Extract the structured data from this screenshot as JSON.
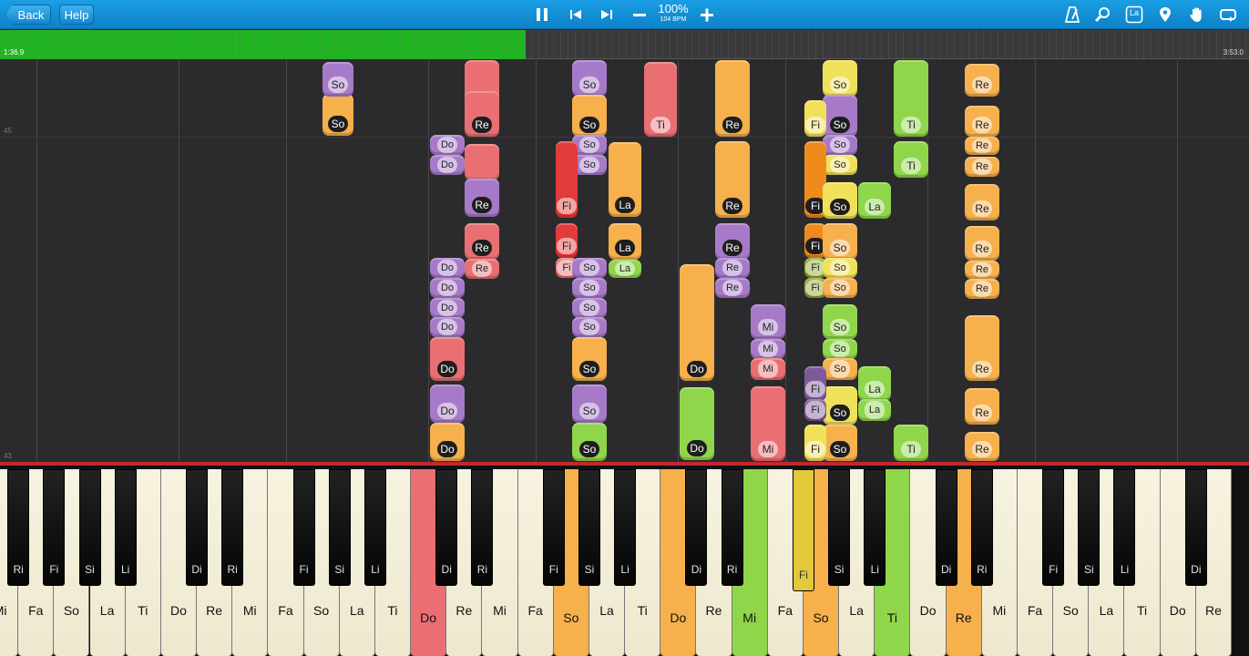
{
  "toolbar": {
    "back_label": "Back",
    "help_label": "Help",
    "zoom": "100%",
    "tempo": "104 BPM",
    "icons": [
      "pause-icon",
      "skip-back-icon",
      "skip-forward-icon",
      "zoom-out-icon",
      "zoom-in-icon",
      "metronome-icon",
      "search-icon",
      "note-label-icon",
      "location-pin-icon",
      "hand-icon",
      "loop-icon"
    ],
    "note_label_icon_text": "La",
    "accent": "#1591d6"
  },
  "progress": {
    "elapsed": "1:36.9",
    "total": "3:53.0",
    "fraction": 0.421
  },
  "measures": [
    "45",
    "43"
  ],
  "colors": {
    "orange": "#f6b04c",
    "purple": "#a77ac9",
    "pink": "#ea6f72",
    "red": "#e33a3a",
    "green": "#8fd64a",
    "yellow": "#f1e15a",
    "deeporange": "#ef8a1c",
    "olive": "#8fa62a",
    "darkpurple": "#7e5a9a"
  },
  "notes": [
    [
      "orange",
      354,
      103,
      34,
      46,
      "So",
      1
    ],
    [
      "purple",
      354,
      68,
      34,
      38,
      "So",
      0
    ],
    [
      "purple",
      472,
      148,
      38,
      22,
      "Do",
      0
    ],
    [
      "purple",
      472,
      170,
      38,
      22,
      "Do",
      0
    ],
    [
      "pink",
      510,
      66,
      38,
      84,
      "Re",
      0
    ],
    [
      "pink",
      510,
      100,
      38,
      50,
      "Re",
      1
    ],
    [
      "pink",
      510,
      158,
      38,
      40,
      "",
      0
    ],
    [
      "purple",
      510,
      196,
      38,
      42,
      "Re",
      1
    ],
    [
      "pink",
      510,
      245,
      38,
      40,
      "Re",
      1
    ],
    [
      "pink",
      510,
      284,
      38,
      22,
      "Re",
      0
    ],
    [
      "purple",
      472,
      283,
      38,
      22,
      "Do",
      0
    ],
    [
      "purple",
      472,
      305,
      38,
      22,
      "Do",
      0
    ],
    [
      "purple",
      472,
      327,
      38,
      22,
      "Do",
      0
    ],
    [
      "purple",
      472,
      348,
      38,
      22,
      "Do",
      0
    ],
    [
      "pink",
      472,
      370,
      38,
      48,
      "Do",
      1
    ],
    [
      "purple",
      472,
      422,
      38,
      42,
      "Do",
      0
    ],
    [
      "orange",
      472,
      464,
      38,
      42,
      "Do",
      1
    ],
    [
      "purple",
      628,
      66,
      38,
      40,
      "So",
      0
    ],
    [
      "orange",
      628,
      104,
      38,
      46,
      "So",
      1
    ],
    [
      "purple",
      628,
      148,
      38,
      22,
      "So",
      0
    ],
    [
      "purple",
      628,
      170,
      38,
      22,
      "So",
      0
    ],
    [
      "red",
      610,
      155,
      24,
      84,
      "Fi",
      0
    ],
    [
      "red",
      610,
      245,
      24,
      38,
      "Fi",
      0
    ],
    [
      "pink",
      610,
      283,
      24,
      22,
      "Fi",
      0
    ],
    [
      "orange",
      668,
      156,
      36,
      82,
      "La",
      1
    ],
    [
      "orange",
      668,
      245,
      36,
      40,
      "La",
      1
    ],
    [
      "green",
      668,
      285,
      36,
      20,
      "La",
      0
    ],
    [
      "purple",
      628,
      283,
      38,
      22,
      "So",
      0
    ],
    [
      "purple",
      628,
      305,
      38,
      22,
      "So",
      0
    ],
    [
      "purple",
      628,
      327,
      38,
      22,
      "So",
      0
    ],
    [
      "purple",
      628,
      348,
      38,
      22,
      "So",
      0
    ],
    [
      "orange",
      628,
      370,
      38,
      48,
      "So",
      1
    ],
    [
      "purple",
      628,
      422,
      38,
      42,
      "So",
      0
    ],
    [
      "green",
      628,
      464,
      38,
      42,
      "So",
      1
    ],
    [
      "pink",
      707,
      68,
      36,
      82,
      "Ti",
      0
    ],
    [
      "orange",
      785,
      66,
      38,
      84,
      "Re",
      1
    ],
    [
      "orange",
      785,
      155,
      38,
      84,
      "Re",
      1
    ],
    [
      "purple",
      785,
      245,
      38,
      40,
      "Re",
      1
    ],
    [
      "purple",
      785,
      283,
      38,
      22,
      "Re",
      0
    ],
    [
      "purple",
      785,
      305,
      38,
      22,
      "Re",
      0
    ],
    [
      "orange",
      746,
      290,
      38,
      128,
      "Do",
      1
    ],
    [
      "green",
      746,
      425,
      38,
      80,
      "Do",
      1
    ],
    [
      "purple",
      824,
      334,
      38,
      38,
      "Mi",
      0
    ],
    [
      "purple",
      824,
      372,
      38,
      22,
      "Mi",
      0
    ],
    [
      "pink",
      824,
      393,
      38,
      24,
      "Mi",
      0
    ],
    [
      "pink",
      824,
      424,
      38,
      82,
      "Mi",
      0
    ],
    [
      "yellow",
      903,
      66,
      38,
      40,
      "So",
      0
    ],
    [
      "purple",
      903,
      104,
      38,
      46,
      "So",
      1
    ],
    [
      "purple",
      903,
      148,
      38,
      22,
      "So",
      0
    ],
    [
      "yellow",
      903,
      170,
      38,
      22,
      "So",
      0
    ],
    [
      "yellow",
      883,
      110,
      24,
      40,
      "Fi",
      0
    ],
    [
      "deeporange",
      883,
      155,
      24,
      84,
      "Fi",
      1
    ],
    [
      "deeporange",
      883,
      245,
      24,
      38,
      "Fi",
      1
    ],
    [
      "olive",
      883,
      283,
      24,
      22,
      "Fi",
      0
    ],
    [
      "olive",
      883,
      305,
      24,
      22,
      "Fi",
      0
    ],
    [
      "yellow",
      903,
      200,
      38,
      40,
      "So",
      1
    ],
    [
      "orange",
      903,
      245,
      38,
      40,
      "So",
      0
    ],
    [
      "yellow",
      903,
      283,
      38,
      22,
      "So",
      0
    ],
    [
      "orange",
      903,
      305,
      38,
      22,
      "So",
      0
    ],
    [
      "green",
      903,
      334,
      38,
      38,
      "So",
      0
    ],
    [
      "green",
      903,
      372,
      38,
      22,
      "So",
      0
    ],
    [
      "orange",
      903,
      393,
      38,
      24,
      "So",
      0
    ],
    [
      "yellow",
      903,
      424,
      38,
      42,
      "So",
      1
    ],
    [
      "orange",
      903,
      466,
      38,
      40,
      "So",
      1
    ],
    [
      "darkpurple",
      883,
      402,
      24,
      38,
      "Fi",
      0
    ],
    [
      "darkpurple",
      883,
      438,
      24,
      24,
      "Fi",
      0
    ],
    [
      "yellow",
      883,
      466,
      24,
      40,
      "Fi",
      0
    ],
    [
      "green",
      942,
      200,
      36,
      40,
      "La",
      0
    ],
    [
      "green",
      942,
      402,
      36,
      38,
      "La",
      0
    ],
    [
      "green",
      942,
      438,
      36,
      24,
      "La",
      0
    ],
    [
      "green",
      981,
      66,
      38,
      84,
      "Ti",
      0
    ],
    [
      "green",
      981,
      155,
      38,
      40,
      "Ti",
      0
    ],
    [
      "green",
      981,
      466,
      38,
      40,
      "Ti",
      0
    ],
    [
      "orange",
      1059,
      70,
      38,
      36,
      "Re",
      0
    ],
    [
      "orange",
      1059,
      116,
      38,
      34,
      "Re",
      0
    ],
    [
      "orange",
      1059,
      150,
      38,
      20,
      "Re",
      0
    ],
    [
      "orange",
      1059,
      172,
      38,
      22,
      "Re",
      0
    ],
    [
      "orange",
      1059,
      202,
      38,
      40,
      "Re",
      0
    ],
    [
      "orange",
      1059,
      248,
      38,
      38,
      "Re",
      0
    ],
    [
      "orange",
      1059,
      286,
      38,
      20,
      "Re",
      0
    ],
    [
      "orange",
      1059,
      306,
      38,
      22,
      "Re",
      0
    ],
    [
      "orange",
      1059,
      346,
      38,
      72,
      "Re",
      0
    ],
    [
      "orange",
      1059,
      426,
      38,
      40,
      "Re",
      0
    ],
    [
      "orange",
      1059,
      474,
      38,
      32,
      "Re",
      0
    ]
  ],
  "keyboard": {
    "white": [
      [
        "Mi",
        ""
      ],
      [
        "Fa",
        ""
      ],
      [
        "So",
        ""
      ],
      [
        "La",
        ""
      ],
      [
        "Ti",
        ""
      ],
      [
        "Do",
        ""
      ],
      [
        "Re",
        ""
      ],
      [
        "Mi",
        ""
      ],
      [
        "Fa",
        ""
      ],
      [
        "So",
        ""
      ],
      [
        "La",
        ""
      ],
      [
        "Ti",
        ""
      ],
      [
        "Do",
        "#ea6f72"
      ],
      [
        "Re",
        ""
      ],
      [
        "Mi",
        ""
      ],
      [
        "Fa",
        ""
      ],
      [
        "So",
        "#f6b04c"
      ],
      [
        "La",
        ""
      ],
      [
        "Ti",
        ""
      ],
      [
        "Do",
        "#f6b04c"
      ],
      [
        "Re",
        ""
      ],
      [
        "Mi",
        "#8fd64a"
      ],
      [
        "Fa",
        ""
      ],
      [
        "So",
        "#f6b04c"
      ],
      [
        "La",
        ""
      ],
      [
        "Ti",
        "#8fd64a"
      ],
      [
        "Do",
        ""
      ],
      [
        "Re",
        "#f6b04c"
      ],
      [
        "Mi",
        ""
      ],
      [
        "Fa",
        ""
      ],
      [
        "So",
        ""
      ],
      [
        "La",
        ""
      ],
      [
        "Ti",
        ""
      ],
      [
        "Do",
        ""
      ],
      [
        "Re",
        ""
      ]
    ],
    "black": [
      [
        "Ri",
        0,
        ""
      ],
      [
        "Fi",
        1,
        ""
      ],
      [
        "Si",
        2,
        ""
      ],
      [
        "Li",
        3,
        ""
      ],
      [
        "Di",
        5,
        ""
      ],
      [
        "Ri",
        6,
        ""
      ],
      [
        "Fi",
        8,
        ""
      ],
      [
        "Si",
        9,
        ""
      ],
      [
        "Li",
        10,
        ""
      ],
      [
        "Di",
        12,
        ""
      ],
      [
        "Ri",
        13,
        ""
      ],
      [
        "Fi",
        15,
        ""
      ],
      [
        "Si",
        16,
        ""
      ],
      [
        "Li",
        17,
        ""
      ],
      [
        "Di",
        19,
        ""
      ],
      [
        "Ri",
        20,
        ""
      ],
      [
        "Fi",
        22,
        "#e3c93a"
      ],
      [
        "Si",
        23,
        ""
      ],
      [
        "Li",
        24,
        ""
      ],
      [
        "Di",
        26,
        ""
      ],
      [
        "Ri",
        27,
        ""
      ],
      [
        "Fi",
        29,
        ""
      ],
      [
        "Si",
        30,
        ""
      ],
      [
        "Li",
        31,
        ""
      ],
      [
        "Di",
        33,
        ""
      ]
    ]
  }
}
